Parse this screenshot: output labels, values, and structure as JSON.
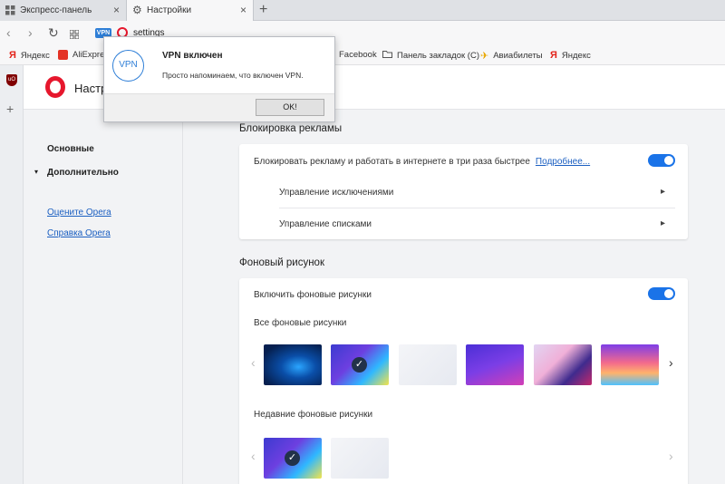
{
  "tabs": [
    {
      "label": "Экспресс-панель",
      "icon": "grid-icon"
    },
    {
      "label": "Настройки",
      "icon": "gear-icon"
    }
  ],
  "address": {
    "vpn_badge": "VPN",
    "url": "settings"
  },
  "bookmarks": [
    {
      "label": "Яндекс",
      "icon": "yandex-icon"
    },
    {
      "label": "AliExpress",
      "icon": "aliexpress-icon"
    },
    {
      "label": "Facebook",
      "icon": "facebook-icon"
    },
    {
      "label": "Панель закладок (С)",
      "icon": "folder-icon"
    },
    {
      "label": "Авиабилеты",
      "icon": "plane-icon"
    },
    {
      "label": "Яндекс",
      "icon": "yandex-icon"
    }
  ],
  "page": {
    "title": "Настройки"
  },
  "nav": {
    "basic": "Основные",
    "advanced": "Дополнительно",
    "rate": "Оцените Opera",
    "help": "Справка Opera"
  },
  "adblock": {
    "section_title": "Блокировка рекламы",
    "toggle_text": "Блокировать рекламу и работать в интернете в три раза быстрее",
    "more_link": "Подробнее...",
    "exceptions": "Управление исключениями",
    "lists": "Управление списками",
    "enabled": true
  },
  "wallpaper": {
    "section_title": "Фоновый рисунок",
    "toggle_text": "Включить фоновые рисунки",
    "enabled": true,
    "all_label": "Все фоновые рисунки",
    "recent_label": "Недавние фоновые рисунки"
  },
  "dialog": {
    "icon_text": "VPN",
    "title": "VPN включен",
    "message": "Просто напоминаем, что включен VPN.",
    "ok": "OK!"
  },
  "colors": {
    "accent": "#1a73e8",
    "opera_red": "#e6172d",
    "vpn_blue": "#2f7fd7"
  }
}
